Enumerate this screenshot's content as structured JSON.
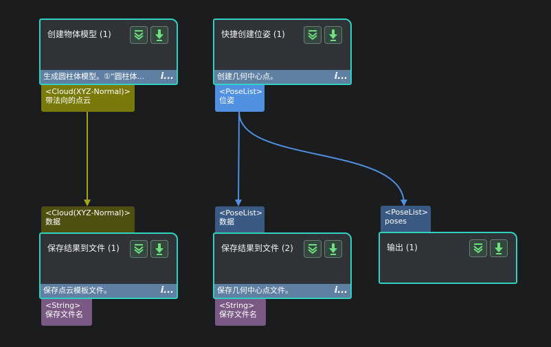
{
  "colors": {
    "node_border": "#2fd3c0",
    "node_body": "#2f3338",
    "node_footer": "#5f7fa3",
    "wire_cloud": "#a3a31a",
    "wire_pose": "#4f90e0",
    "port_cloud": "#7a7a0a",
    "port_pose": "#4f90e0",
    "port_string": "#7a5a84"
  },
  "nodes": {
    "create_model": {
      "title": "创建物体模型 (1)",
      "footer": "生成圆柱体模型。①“圆柱体...",
      "output": {
        "type": "<Cloud(XYZ-Normal)>",
        "name": "带法向的点云"
      }
    },
    "create_pose": {
      "title": "快捷创建位姿 (1)",
      "footer": "创建几何中心点。",
      "output": {
        "type": "<PoseList>",
        "name": "位姿"
      }
    },
    "save_cloud": {
      "title": "保存结果到文件 (1)",
      "footer": "保存点云模板文件。",
      "input": {
        "type": "<Cloud(XYZ-Normal)>",
        "name": "数据"
      },
      "extra": {
        "type": "<String>",
        "name": "保存文件名"
      }
    },
    "save_pose": {
      "title": "保存结果到文件 (2)",
      "footer": "保存几何中心点文件。",
      "input": {
        "type": "<PoseList>",
        "name": "数据"
      },
      "extra": {
        "type": "<String>",
        "name": "保存文件名"
      }
    },
    "output": {
      "title": "输出 (1)",
      "input": {
        "type": "<PoseList>",
        "name": "poses"
      }
    }
  },
  "icons": {
    "node_button_a": "double-chevron-down-icon",
    "node_button_b": "download-arrow-icon",
    "footer_info": "info-icon"
  },
  "info_glyph": "i..."
}
